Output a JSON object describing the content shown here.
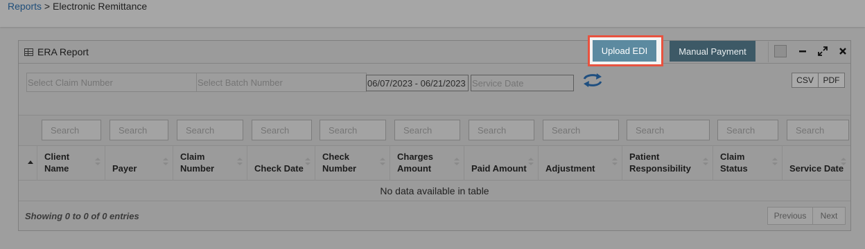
{
  "breadcrumb": {
    "parent": "Reports",
    "separator": " > ",
    "current": "Electronic Remittance"
  },
  "panel": {
    "title": "ERA Report"
  },
  "buttons": {
    "upload_edi": "Upload EDI",
    "manual_payment": "Manual Payment"
  },
  "filters": {
    "claim_placeholder": "Select Claim Number",
    "batch_placeholder": "Select Batch Number",
    "date_range": "06/07/2023 - 06/21/2023",
    "service_date_placeholder": "Service Date"
  },
  "export": {
    "csv": "CSV",
    "pdf": "PDF"
  },
  "table": {
    "search_placeholder": "Search",
    "columns": [
      "Client\nName",
      "Payer",
      "Claim\nNumber",
      "Check Date",
      "Check\nNumber",
      "Charges\nAmount",
      "Paid Amount",
      "Adjustment",
      "Patient\nResponsibility",
      "Claim\nStatus",
      "Service Date"
    ],
    "empty_message": "No data available in table",
    "info": "Showing 0 to 0 of 0 entries"
  },
  "pagination": {
    "previous": "Previous",
    "next": "Next"
  },
  "colors": {
    "upload_button": "#5c8aa0",
    "manual_button": "#3d5966",
    "highlight": "#e8523f",
    "link": "#1f4e7a"
  }
}
